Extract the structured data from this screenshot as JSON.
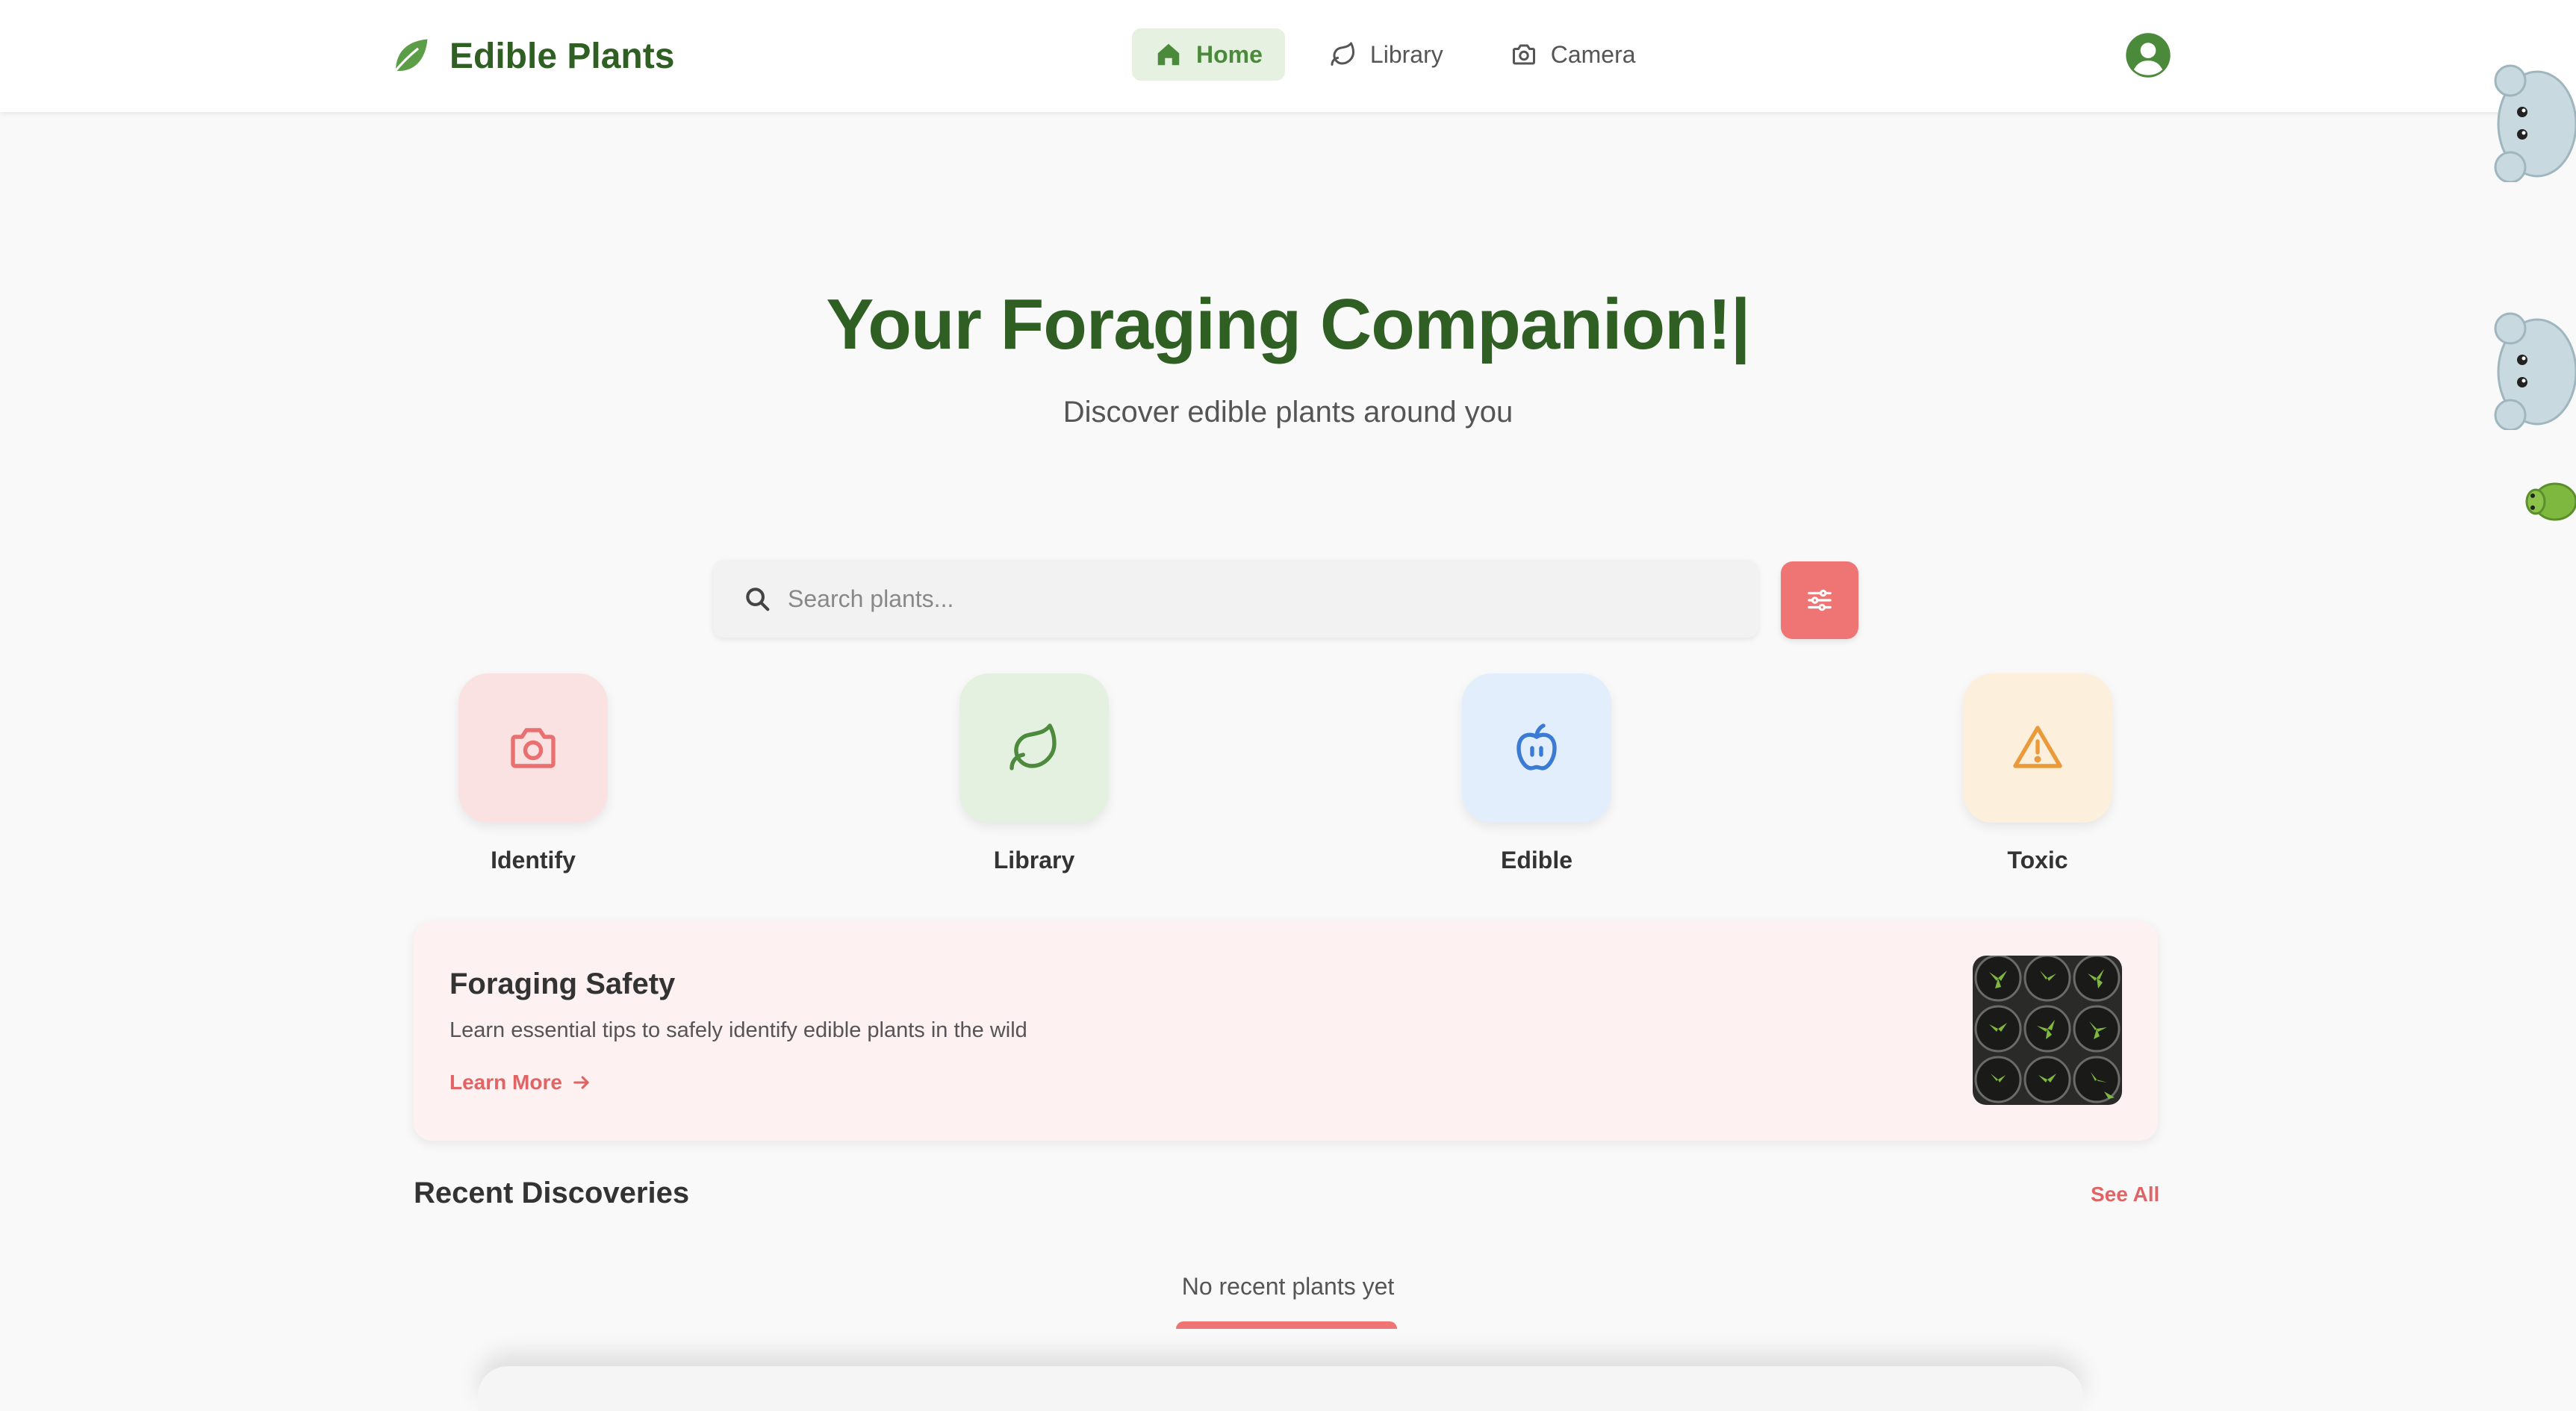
{
  "header": {
    "brand_title": "Edible Plants",
    "nav": [
      {
        "label": "Home",
        "icon": "home-icon",
        "active": true
      },
      {
        "label": "Library",
        "icon": "leaf-icon",
        "active": false
      },
      {
        "label": "Camera",
        "icon": "camera-icon",
        "active": false
      }
    ],
    "avatar_icon": "user-circle-icon"
  },
  "hero": {
    "title": "Your Foraging Companion!|",
    "subtitle": "Discover edible plants around you"
  },
  "search": {
    "placeholder": "Search plants...",
    "value": ""
  },
  "quick_actions": [
    {
      "label": "Identify",
      "icon": "camera-icon",
      "bg": "#fbe2e2",
      "color": "#e87070"
    },
    {
      "label": "Library",
      "icon": "leaf-icon",
      "bg": "#e4f1e1",
      "color": "#4e8a3e"
    },
    {
      "label": "Edible",
      "icon": "apple-icon",
      "bg": "#e2eefb",
      "color": "#3b7bd4"
    },
    {
      "label": "Toxic",
      "icon": "warning-icon",
      "bg": "#fcf0dd",
      "color": "#ea9a3a"
    }
  ],
  "safety_card": {
    "title": "Foraging Safety",
    "description": "Learn essential tips to safely identify edible plants in the wild",
    "link_label": "Learn More"
  },
  "recent": {
    "title": "Recent Discoveries",
    "see_all_label": "See All",
    "empty_text": "No recent plants yet"
  },
  "colors": {
    "brand_green": "#2f5f23",
    "accent_red": "#ef7474",
    "nav_active_bg": "#e6f1e2"
  }
}
